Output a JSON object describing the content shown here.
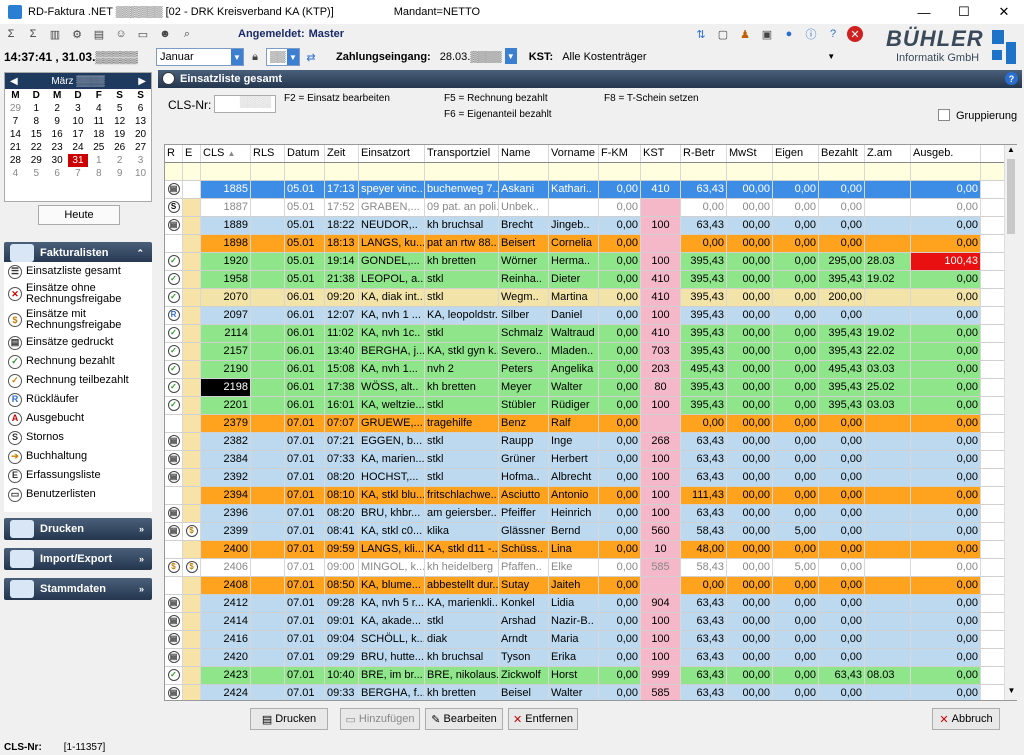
{
  "window": {
    "title": "RD-Faktura .NET ▒▒▒▒▒▒ [02 - DRK Kreisverband KA (KTP)]",
    "mandant": "Mandant=NETTO",
    "min": "—",
    "max": "☐",
    "close": "✕"
  },
  "toolbar": {
    "login_label": "Angemeldet:",
    "login_user": "Master",
    "clock": "14:37:41 , 31.03.▒▒▒▒▒",
    "month": "Januar",
    "zahlungseingang_label": "Zahlungseingang:",
    "zahlungseingang_value": "28.03.▒▒▒▒",
    "kst_label": "KST:",
    "kst_value": "Alle Kostenträger"
  },
  "brand": {
    "name": "BÜHLER",
    "sub": "Informatik GmbH",
    "colors": {
      "blue": "#1e73c8"
    }
  },
  "calendar": {
    "month": "März ▒▒▒▒",
    "days_header": [
      "M",
      "D",
      "M",
      "D",
      "F",
      "S",
      "S"
    ],
    "weeks": [
      [
        "29",
        "1",
        "2",
        "3",
        "4",
        "5",
        "6"
      ],
      [
        "7",
        "8",
        "9",
        "10",
        "11",
        "12",
        "13"
      ],
      [
        "14",
        "15",
        "16",
        "17",
        "18",
        "19",
        "20"
      ],
      [
        "21",
        "22",
        "23",
        "24",
        "25",
        "26",
        "27"
      ],
      [
        "28",
        "29",
        "30",
        "31",
        "1",
        "2",
        "3"
      ],
      [
        "4",
        "5",
        "6",
        "7",
        "8",
        "9",
        "10"
      ]
    ],
    "today": "31",
    "heute": "Heute"
  },
  "nav": {
    "fakturalisten": "Fakturalisten",
    "drucken": "Drucken",
    "import_export": "Import/Export",
    "stammdaten": "Stammdaten",
    "items": [
      {
        "label": "Einsatzliste gesamt",
        "icon": "list-icon"
      },
      {
        "label": "Einsätze ohne Rechnungsfreigabe",
        "icon": "x-circle-icon"
      },
      {
        "label": "Einsätze mit Rechnungsfreigabe",
        "icon": "coin-icon"
      },
      {
        "label": "Einsätze gedruckt",
        "icon": "printer-icon"
      },
      {
        "label": "Rechnung bezahlt",
        "icon": "check-green-icon"
      },
      {
        "label": "Rechnung teilbezahlt",
        "icon": "check-orange-icon"
      },
      {
        "label": "Rückläufer",
        "icon": "r-icon"
      },
      {
        "label": "Ausgebucht",
        "icon": "a-icon"
      },
      {
        "label": "Stornos",
        "icon": "s-icon"
      },
      {
        "label": "Buchhaltung",
        "icon": "arrow-icon"
      },
      {
        "label": "Erfassungsliste",
        "icon": "e-icon"
      },
      {
        "label": "Benutzerlisten",
        "icon": "doc-icon"
      }
    ]
  },
  "main": {
    "title": "Einsatzliste gesamt",
    "cls_label": "CLS-Nr:",
    "cls_value": "▒▒▒▒",
    "hints": [
      "F2 = Einsatz bearbeiten",
      "F5 = Rechnung bezahlt",
      "F6 = Eigenanteil bezahlt",
      "F8 = T-Schein setzen"
    ],
    "gruppierung": "Gruppierung"
  },
  "grid": {
    "columns": [
      "R",
      "E",
      "CLS",
      "RLS",
      "Datum",
      "Zeit",
      "Einsatzort",
      "Transportziel",
      "Name",
      "Vorname",
      "F-KM",
      "KST",
      "R-Betr",
      "MwSt",
      "Eigen",
      "Bezahlt",
      "Z.am",
      "Ausgeb."
    ],
    "rows": [
      {
        "r": "P",
        "e": "",
        "cls": "1885",
        "date": "05.01",
        "time": "17:13",
        "ort": "speyer vinc..",
        "ziel": "buchenweg 7..",
        "name": "Askani",
        "vor": "Kathari..",
        "fkm": "0,00",
        "kst": "410",
        "rb": "63,43",
        "mw": "00,00",
        "eig": "0,00",
        "bez": "0,00",
        "zam": "",
        "aus": "0,00",
        "c": "sel"
      },
      {
        "r": "S",
        "e": "",
        "cls": "1887",
        "date": "05.01",
        "time": "17:52",
        "ort": "GRABEN,...",
        "ziel": "09 pat. an poli..",
        "name": "Unbek..",
        "vor": "",
        "fkm": "0,00",
        "kst": "",
        "rb": "0,00",
        "mw": "00,00",
        "eig": "0,00",
        "bez": "0,00",
        "zam": "",
        "aus": "0,00",
        "c": "white"
      },
      {
        "r": "P",
        "e": "",
        "cls": "1889",
        "date": "05.01",
        "time": "18:22",
        "ort": "NEUDOR,..",
        "ziel": "kh bruchsal",
        "name": "Brecht",
        "vor": "Jingeb..",
        "fkm": "0,00",
        "kst": "100",
        "rb": "63,43",
        "mw": "00,00",
        "eig": "0,00",
        "bez": "0,00",
        "zam": "",
        "aus": "0,00",
        "c": "blue"
      },
      {
        "r": "",
        "e": "",
        "cls": "1898",
        "date": "05.01",
        "time": "18:13",
        "ort": "LANGS, ku...",
        "ziel": "pat an rtw 88..",
        "name": "Beisert",
        "vor": "Cornelia",
        "fkm": "0,00",
        "kst": "",
        "rb": "0,00",
        "mw": "00,00",
        "eig": "0,00",
        "bez": "0,00",
        "zam": "",
        "aus": "0,00",
        "c": "orange"
      },
      {
        "r": "C",
        "e": "",
        "cls": "1920",
        "date": "05.01",
        "time": "19:14",
        "ort": "GONDEL,...",
        "ziel": "kh bretten",
        "name": "Wörner",
        "vor": "Herma..",
        "fkm": "0,00",
        "kst": "100",
        "rb": "395,43",
        "mw": "00,00",
        "eig": "0,00",
        "bez": "295,00",
        "zam": "28.03",
        "aus": "100,43",
        "c": "green",
        "ausred": true
      },
      {
        "r": "C",
        "e": "",
        "cls": "1958",
        "date": "05.01",
        "time": "21:38",
        "ort": "LEOPOL, a...",
        "ziel": "stkl",
        "name": "Reinha..",
        "vor": "Dieter",
        "fkm": "0,00",
        "kst": "410",
        "rb": "395,43",
        "mw": "00,00",
        "eig": "0,00",
        "bez": "395,43",
        "zam": "19.02",
        "aus": "0,00",
        "c": "green"
      },
      {
        "r": "C",
        "e": "",
        "cls": "2070",
        "date": "06.01",
        "time": "09:20",
        "ort": "KA, diak int..",
        "ziel": "stkl",
        "name": "Wegm..",
        "vor": "Martina",
        "fkm": "0,00",
        "kst": "410",
        "rb": "395,43",
        "mw": "00,00",
        "eig": "0,00",
        "bez": "200,00",
        "zam": "",
        "aus": "0,00",
        "c": "yellow"
      },
      {
        "r": "R",
        "e": "",
        "cls": "2097",
        "date": "06.01",
        "time": "12:07",
        "ort": "KA, nvh 1 ...",
        "ziel": "KA, leopoldstr..",
        "name": "Silber",
        "vor": "Daniel",
        "fkm": "0,00",
        "kst": "100",
        "rb": "395,43",
        "mw": "00,00",
        "eig": "0,00",
        "bez": "0,00",
        "zam": "",
        "aus": "0,00",
        "c": "blue"
      },
      {
        "r": "C",
        "e": "",
        "cls": "2114",
        "date": "06.01",
        "time": "11:02",
        "ort": "KA, nvh 1c..",
        "ziel": "stkl",
        "name": "Schmalz",
        "vor": "Waltraud",
        "fkm": "0,00",
        "kst": "410",
        "rb": "395,43",
        "mw": "00,00",
        "eig": "0,00",
        "bez": "395,43",
        "zam": "19.02",
        "aus": "0,00",
        "c": "green"
      },
      {
        "r": "C",
        "e": "",
        "cls": "2157",
        "date": "06.01",
        "time": "13:40",
        "ort": "BERGHA, j...",
        "ziel": "KA, stkl gyn k..",
        "name": "Severo..",
        "vor": "Mladen..",
        "fkm": "0,00",
        "kst": "703",
        "rb": "395,43",
        "mw": "00,00",
        "eig": "0,00",
        "bez": "395,43",
        "zam": "22.02",
        "aus": "0,00",
        "c": "green"
      },
      {
        "r": "C",
        "e": "",
        "cls": "2190",
        "date": "06.01",
        "time": "15:08",
        "ort": "KA, nvh 1...",
        "ziel": "nvh 2",
        "name": "Peters",
        "vor": "Angelika",
        "fkm": "0,00",
        "kst": "203",
        "rb": "495,43",
        "mw": "00,00",
        "eig": "0,00",
        "bez": "495,43",
        "zam": "03.03",
        "aus": "0,00",
        "c": "green"
      },
      {
        "r": "C",
        "e": "",
        "cls": "2198",
        "date": "06.01",
        "time": "17:38",
        "ort": "WÖSS, alt..",
        "ziel": "kh bretten",
        "name": "Meyer",
        "vor": "Walter",
        "fkm": "0,00",
        "kst": "80",
        "rb": "395,43",
        "mw": "00,00",
        "eig": "0,00",
        "bez": "395,43",
        "zam": "25.02",
        "aus": "0,00",
        "c": "green",
        "clsblack": true
      },
      {
        "r": "C",
        "e": "",
        "cls": "2201",
        "date": "06.01",
        "time": "16:01",
        "ort": "KA, weltzie...",
        "ziel": "stkl",
        "name": "Stübler",
        "vor": "Rüdiger",
        "fkm": "0,00",
        "kst": "100",
        "rb": "395,43",
        "mw": "00,00",
        "eig": "0,00",
        "bez": "395,43",
        "zam": "03.03",
        "aus": "0,00",
        "c": "green"
      },
      {
        "r": "",
        "e": "",
        "cls": "2379",
        "date": "07.01",
        "time": "07:07",
        "ort": "GRUEWE,...",
        "ziel": "tragehilfe",
        "name": "Benz",
        "vor": "Ralf",
        "fkm": "0,00",
        "kst": "",
        "rb": "0,00",
        "mw": "00,00",
        "eig": "0,00",
        "bez": "0,00",
        "zam": "",
        "aus": "0,00",
        "c": "orange"
      },
      {
        "r": "P",
        "e": "",
        "cls": "2382",
        "date": "07.01",
        "time": "07:21",
        "ort": "EGGEN, b...",
        "ziel": "stkl",
        "name": "Raupp",
        "vor": "Inge",
        "fkm": "0,00",
        "kst": "268",
        "rb": "63,43",
        "mw": "00,00",
        "eig": "0,00",
        "bez": "0,00",
        "zam": "",
        "aus": "0,00",
        "c": "blue"
      },
      {
        "r": "P",
        "e": "",
        "cls": "2384",
        "date": "07.01",
        "time": "07:33",
        "ort": "KA, marien...",
        "ziel": "stkl",
        "name": "Grüner",
        "vor": "Herbert",
        "fkm": "0,00",
        "kst": "100",
        "rb": "63,43",
        "mw": "00,00",
        "eig": "0,00",
        "bez": "0,00",
        "zam": "",
        "aus": "0,00",
        "c": "blue"
      },
      {
        "r": "P",
        "e": "",
        "cls": "2392",
        "date": "07.01",
        "time": "08:20",
        "ort": "HOCHST,...",
        "ziel": "stkl",
        "name": "Hofma..",
        "vor": "Albrecht",
        "fkm": "0,00",
        "kst": "100",
        "rb": "63,43",
        "mw": "00,00",
        "eig": "0,00",
        "bez": "0,00",
        "zam": "",
        "aus": "0,00",
        "c": "blue"
      },
      {
        "r": "",
        "e": "",
        "cls": "2394",
        "date": "07.01",
        "time": "08:10",
        "ort": "KA, stkl blu...",
        "ziel": "fritschlachwe..",
        "name": "Asciutto",
        "vor": "Antonio",
        "fkm": "0,00",
        "kst": "100",
        "rb": "111,43",
        "mw": "00,00",
        "eig": "0,00",
        "bez": "0,00",
        "zam": "",
        "aus": "0,00",
        "c": "orange"
      },
      {
        "r": "P",
        "e": "",
        "cls": "2396",
        "date": "07.01",
        "time": "08:20",
        "ort": "BRU, khbr...",
        "ziel": "am geiersber..",
        "name": "Pfeiffer",
        "vor": "Heinrich",
        "fkm": "0,00",
        "kst": "100",
        "rb": "63,43",
        "mw": "00,00",
        "eig": "0,00",
        "bez": "0,00",
        "zam": "",
        "aus": "0,00",
        "c": "blue"
      },
      {
        "r": "P",
        "e": "$",
        "cls": "2399",
        "date": "07.01",
        "time": "08:41",
        "ort": "KA, stkl c0...",
        "ziel": "klika",
        "name": "Glässner",
        "vor": "Bernd",
        "fkm": "0,00",
        "kst": "560",
        "rb": "58,43",
        "mw": "00,00",
        "eig": "5,00",
        "bez": "0,00",
        "zam": "",
        "aus": "0,00",
        "c": "blue"
      },
      {
        "r": "",
        "e": "",
        "cls": "2400",
        "date": "07.01",
        "time": "09:59",
        "ort": "LANGS, kli...",
        "ziel": "KA, stkl d11 -...",
        "name": "Schüss..",
        "vor": "Lina",
        "fkm": "0,00",
        "kst": "10",
        "rb": "48,00",
        "mw": "00,00",
        "eig": "0,00",
        "bez": "0,00",
        "zam": "",
        "aus": "0,00",
        "c": "orange"
      },
      {
        "r": "$",
        "e": "$",
        "cls": "2406",
        "date": "07.01",
        "time": "09:00",
        "ort": "MINGOL, k...",
        "ziel": "kh heidelberg",
        "name": "Pfaffen..",
        "vor": "Elke",
        "fkm": "0,00",
        "kst": "585",
        "rb": "58,43",
        "mw": "00,00",
        "eig": "5,00",
        "bez": "0,00",
        "zam": "",
        "aus": "0,00",
        "c": "white"
      },
      {
        "r": "",
        "e": "",
        "cls": "2408",
        "date": "07.01",
        "time": "08:50",
        "ort": "KA, blume...",
        "ziel": "abbestellt dur..",
        "name": "Sutay",
        "vor": "Jaiteh",
        "fkm": "0,00",
        "kst": "",
        "rb": "0,00",
        "mw": "00,00",
        "eig": "0,00",
        "bez": "0,00",
        "zam": "",
        "aus": "0,00",
        "c": "orange"
      },
      {
        "r": "P",
        "e": "",
        "cls": "2412",
        "date": "07.01",
        "time": "09:28",
        "ort": "KA, nvh 5 r...",
        "ziel": "KA, marienkli..",
        "name": "Konkel",
        "vor": "Lidia",
        "fkm": "0,00",
        "kst": "904",
        "rb": "63,43",
        "mw": "00,00",
        "eig": "0,00",
        "bez": "0,00",
        "zam": "",
        "aus": "0,00",
        "c": "blue"
      },
      {
        "r": "P",
        "e": "",
        "cls": "2414",
        "date": "07.01",
        "time": "09:01",
        "ort": "KA, akade...",
        "ziel": "stkl",
        "name": "Arshad",
        "vor": "Nazir-B..",
        "fkm": "0,00",
        "kst": "100",
        "rb": "63,43",
        "mw": "00,00",
        "eig": "0,00",
        "bez": "0,00",
        "zam": "",
        "aus": "0,00",
        "c": "blue"
      },
      {
        "r": "P",
        "e": "",
        "cls": "2416",
        "date": "07.01",
        "time": "09:04",
        "ort": "SCHÖLL, k...",
        "ziel": "diak",
        "name": "Arndt",
        "vor": "Maria",
        "fkm": "0,00",
        "kst": "100",
        "rb": "63,43",
        "mw": "00,00",
        "eig": "0,00",
        "bez": "0,00",
        "zam": "",
        "aus": "0,00",
        "c": "blue"
      },
      {
        "r": "P",
        "e": "",
        "cls": "2420",
        "date": "07.01",
        "time": "09:29",
        "ort": "BRU, hutte...",
        "ziel": "kh bruchsal",
        "name": "Tyson",
        "vor": "Erika",
        "fkm": "0,00",
        "kst": "100",
        "rb": "63,43",
        "mw": "00,00",
        "eig": "0,00",
        "bez": "0,00",
        "zam": "",
        "aus": "0,00",
        "c": "blue"
      },
      {
        "r": "C",
        "e": "",
        "cls": "2423",
        "date": "07.01",
        "time": "10:40",
        "ort": "BRE, im br...",
        "ziel": "BRE, nikolaus...",
        "name": "Zickwolf",
        "vor": "Horst",
        "fkm": "0,00",
        "kst": "999",
        "rb": "63,43",
        "mw": "00,00",
        "eig": "0,00",
        "bez": "63,43",
        "zam": "08.03",
        "aus": "0,00",
        "c": "green"
      },
      {
        "r": "P",
        "e": "",
        "cls": "2424",
        "date": "07.01",
        "time": "09:33",
        "ort": "BERGHA, f...",
        "ziel": "kh bretten",
        "name": "Beisel",
        "vor": "Walter",
        "fkm": "0,00",
        "kst": "585",
        "rb": "63,43",
        "mw": "00,00",
        "eig": "0,00",
        "bez": "0,00",
        "zam": "",
        "aus": "0,00",
        "c": "blue"
      }
    ]
  },
  "buttons": {
    "drucken": "Drucken",
    "hinzufuegen": "Hinzufügen",
    "bearbeiten": "Bearbeiten",
    "entfernen": "Entfernen",
    "abbruch": "Abbruch"
  },
  "status": {
    "label": "CLS-Nr:",
    "value": "[1-11357]"
  }
}
